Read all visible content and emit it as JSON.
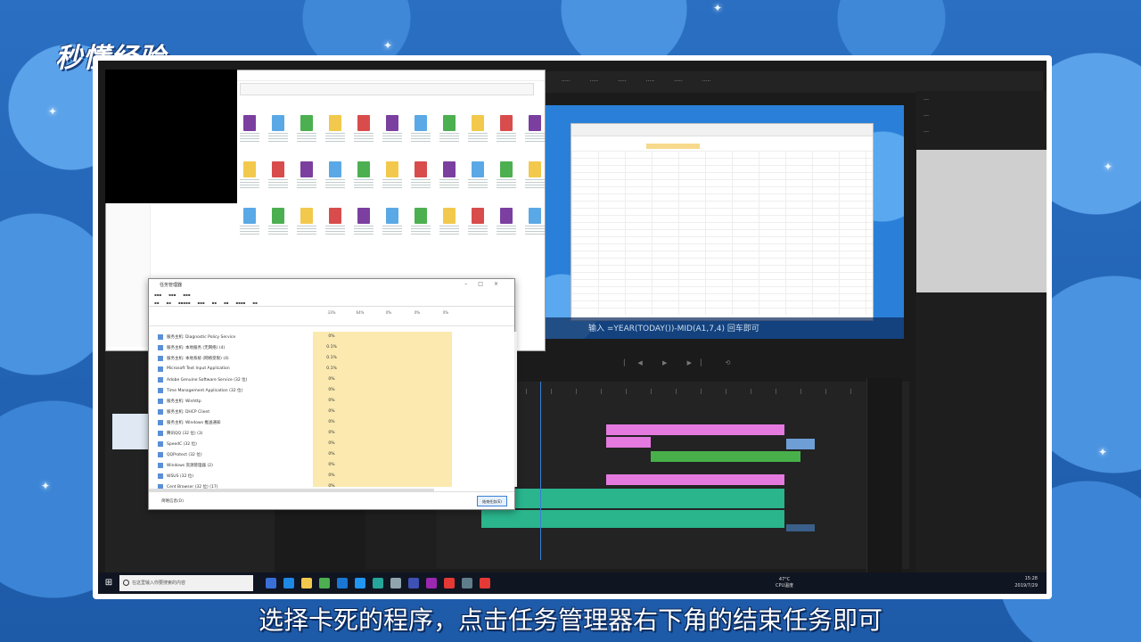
{
  "overlay": {
    "logo_text": "秒懂经验",
    "caption": "选择卡死的程序，点击任务管理器右下角的结束任务即可"
  },
  "editor": {
    "preview_subtitle": "输入 =YEAR(TODAY())-MID(A1,7,4) 回车即可"
  },
  "task_manager": {
    "title": "任务管理器",
    "columns": [
      "33%",
      "64%",
      "0%",
      "0%",
      "0%"
    ],
    "processes": [
      {
        "name": "服务主机: Diagnostic Policy Service",
        "cpu": "0%"
      },
      {
        "name": "服务主机: 本地服务 (无网络) (4)",
        "cpu": "0.1%"
      },
      {
        "name": "服务主机: 本地系统 (网络受限) (4)",
        "cpu": "0.1%"
      },
      {
        "name": "Microsoft Text Input Application",
        "cpu": "0.1%"
      },
      {
        "name": "Adobe Genuine Software Service (32 位)",
        "cpu": "0%"
      },
      {
        "name": "Time Management Application (32 位)",
        "cpu": "0%"
      },
      {
        "name": "服务主机: Winhttp",
        "cpu": "0%"
      },
      {
        "name": "服务主机: DHCP Client",
        "cpu": "0%"
      },
      {
        "name": "服务主机: Windows 推送通知",
        "cpu": "0%"
      },
      {
        "name": "腾讯QQ (32 位) (3)",
        "cpu": "0%"
      },
      {
        "name": "SpeedC (32 位)",
        "cpu": "0%"
      },
      {
        "name": "QQProtect (32 位)",
        "cpu": "0%"
      },
      {
        "name": "Windows 资源管理器 (2)",
        "cpu": "0%"
      },
      {
        "name": "WSUS (32 位)",
        "cpu": "0%"
      },
      {
        "name": "Cent Browser (32 位) (17)",
        "cpu": "0%"
      }
    ],
    "fewer_details": "简略信息(D)",
    "end_task_button": "结束任务(E)"
  },
  "taskbar": {
    "search_placeholder": "在这里输入你要搜索的内容",
    "temp": "47°C",
    "temp_label": "CPU温度",
    "time": "15:28",
    "date": "2019/7/29"
  }
}
